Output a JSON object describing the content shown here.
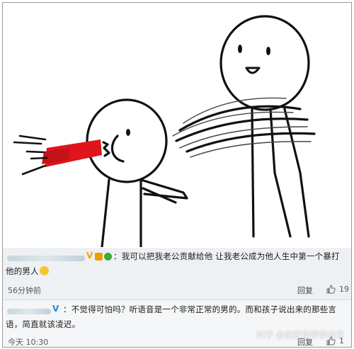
{
  "comments": [
    {
      "text": "：我可以把我老公贡献给他 让我老公成为他人生中第一个暴打他的男人",
      "time": "56分钟前",
      "reply_label": "回复",
      "likes": "19",
      "badge": "V"
    },
    {
      "text": "：不觉得可怕吗？听语音是一个非常正常的男的。而和孩子说出来的那些言语，简直就该凌迟。",
      "time": "今天 10:30",
      "reply_label": "回复",
      "likes": "1",
      "badge": "V"
    }
  ],
  "watermark": "知乎 @信凯律师事务所",
  "colors": {
    "blood": "#e0141b",
    "badge_gold": "#f0a300",
    "badge_blue": "#2b86d9"
  }
}
